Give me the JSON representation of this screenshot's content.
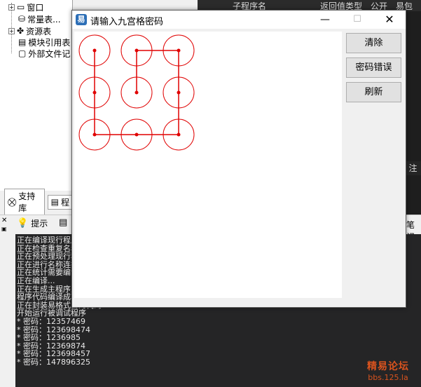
{
  "background": {
    "tree": {
      "items": [
        {
          "label": "窗口",
          "icon": "window-icon"
        },
        {
          "label": "常量表...",
          "icon": "constants-icon"
        },
        {
          "label": "资源表",
          "icon": "resource-icon"
        },
        {
          "label": "模块引用表",
          "icon": "module-icon"
        },
        {
          "label": "外部文件记",
          "icon": "file-icon"
        }
      ]
    },
    "tabs": {
      "support": "支持库",
      "program": "程"
    },
    "header": {
      "col_name": "子程序名",
      "col_return": "返回值类型",
      "col_public": "公开",
      "col_package": "易包"
    },
    "right_label": "注",
    "toolbar": {
      "hint": "提示",
      "notes": "笔记"
    },
    "output_lines": [
      "正在编译现行程序",
      "正在检查重复名称...",
      "正在预处理现行程序",
      "正在进行名称连接...",
      "正在统计需要编译的子程序",
      "正在编译...",
      "正在生成主程序入口代码",
      "程序代码编译成功",
      "正在封装易格式目的代码",
      "开始运行被调试程序",
      "* 密码：12357469",
      "* 密码：123698474",
      "* 密码：1236985",
      "* 密码：12369874",
      "* 密码：123698457",
      "* 密码：147896325"
    ],
    "watermark": {
      "line1": "精易论坛",
      "line2": "bbs.125.la"
    }
  },
  "dialog": {
    "title": "请输入九宫格密码",
    "buttons": {
      "clear": "清除",
      "wrong": "密码错误",
      "refresh": "刷新"
    },
    "pattern": {
      "grid_rows": 3,
      "grid_cols": 3,
      "path": [
        1,
        4,
        7,
        8,
        9,
        6,
        3,
        2,
        5
      ],
      "color": "#e00000"
    }
  },
  "colors": {
    "accent": "#e00000",
    "output_bg": "#252526",
    "watermark": "#d9531e"
  }
}
